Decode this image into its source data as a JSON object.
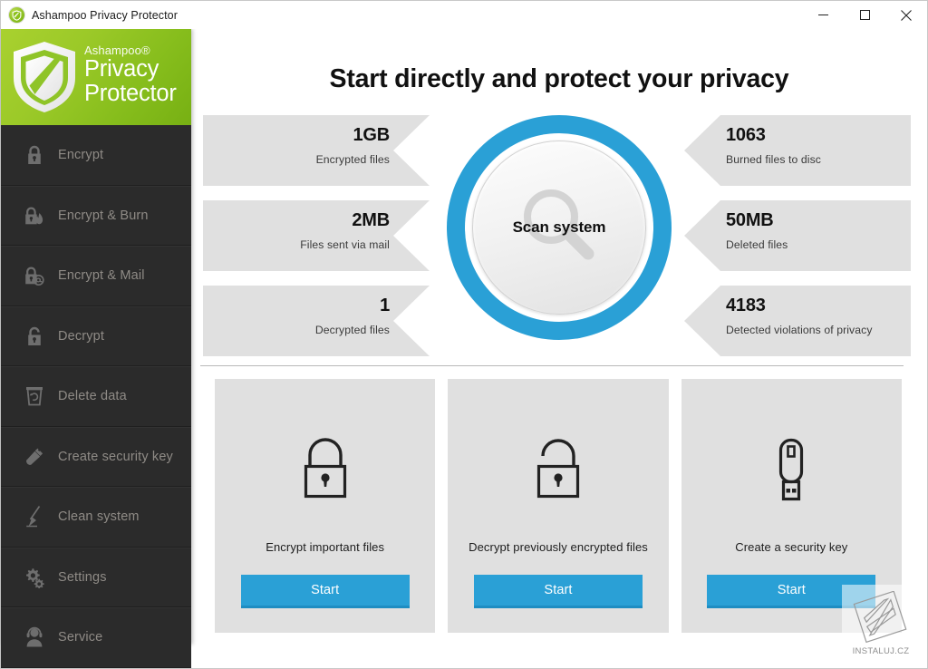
{
  "window": {
    "title": "Ashampoo Privacy Protector",
    "app_icon": "shield-icon",
    "controls": {
      "minimize": "minimize-icon",
      "maximize": "maximize-icon",
      "close": "close-icon"
    }
  },
  "brand": {
    "superscript": "Ashampoo®",
    "line1": "Privacy",
    "line2": "Protector",
    "bg_from": "#a9d12f",
    "bg_to": "#77b013"
  },
  "sidebar": {
    "items": [
      {
        "label": "Encrypt",
        "icon": "lock-closed-icon"
      },
      {
        "label": "Encrypt & Burn",
        "icon": "lock-flame-icon"
      },
      {
        "label": "Encrypt & Mail",
        "icon": "lock-mail-icon"
      },
      {
        "label": "Decrypt",
        "icon": "lock-open-icon"
      },
      {
        "label": "Delete data",
        "icon": "trash-icon"
      },
      {
        "label": "Create security key",
        "icon": "usb-key-icon"
      },
      {
        "label": "Clean system",
        "icon": "broom-icon"
      },
      {
        "label": "Settings",
        "icon": "gears-icon"
      },
      {
        "label": "Service",
        "icon": "headset-person-icon"
      }
    ]
  },
  "main": {
    "page_title": "Start directly and protect your privacy",
    "accent_color": "#2aa0d6",
    "scan": {
      "label": "Scan system",
      "icon": "magnifier-icon"
    },
    "stats_left": [
      {
        "value": "1GB",
        "label": "Encrypted files"
      },
      {
        "value": "2MB",
        "label": "Files sent via mail"
      },
      {
        "value": "1",
        "label": "Decrypted files"
      }
    ],
    "stats_right": [
      {
        "value": "1063",
        "label": "Burned files to disc"
      },
      {
        "value": "50MB",
        "label": "Deleted files"
      },
      {
        "value": "4183",
        "label": "Detected violations of privacy"
      }
    ],
    "cards": [
      {
        "label": "Encrypt important files",
        "icon": "lock-closed-icon",
        "button": "Start"
      },
      {
        "label": "Decrypt previously encrypted files",
        "icon": "lock-open-icon",
        "button": "Start"
      },
      {
        "label": "Create a security key",
        "icon": "usb-key-icon",
        "button": "Start"
      }
    ]
  },
  "watermark": {
    "text": "INSTALUJ.CZ",
    "icon": "instaluj-logo-icon"
  }
}
